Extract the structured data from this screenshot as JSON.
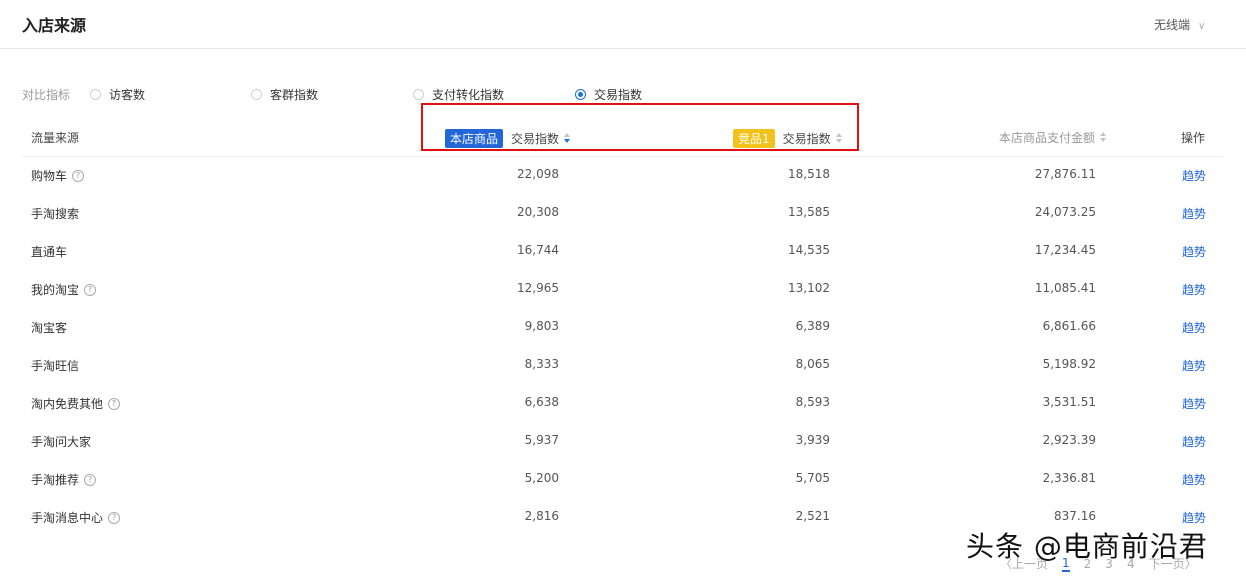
{
  "header": {
    "title": "入店来源",
    "device_select": "无线端"
  },
  "indicators": {
    "label": "对比指标",
    "options": [
      {
        "label": "访客数",
        "checked": false
      },
      {
        "label": "客群指数",
        "checked": false
      },
      {
        "label": "支付转化指数",
        "checked": false
      },
      {
        "label": "交易指数",
        "checked": true
      }
    ]
  },
  "table": {
    "columns": {
      "source": "流量来源",
      "store_tag": "本店商品",
      "store_metric": "交易指数",
      "comp_tag": "竞品1",
      "comp_metric": "交易指数",
      "amount": "本店商品支付金额",
      "action": "操作"
    },
    "rows": [
      {
        "source": "购物车",
        "help": true,
        "store": "22,098",
        "comp": "18,518",
        "amount": "27,876.11",
        "action": "趋势"
      },
      {
        "source": "手淘搜索",
        "help": false,
        "store": "20,308",
        "comp": "13,585",
        "amount": "24,073.25",
        "action": "趋势"
      },
      {
        "source": "直通车",
        "help": false,
        "store": "16,744",
        "comp": "14,535",
        "amount": "17,234.45",
        "action": "趋势"
      },
      {
        "source": "我的淘宝",
        "help": true,
        "store": "12,965",
        "comp": "13,102",
        "amount": "11,085.41",
        "action": "趋势"
      },
      {
        "source": "淘宝客",
        "help": false,
        "store": "9,803",
        "comp": "6,389",
        "amount": "6,861.66",
        "action": "趋势"
      },
      {
        "source": "手淘旺信",
        "help": false,
        "store": "8,333",
        "comp": "8,065",
        "amount": "5,198.92",
        "action": "趋势"
      },
      {
        "source": "淘内免费其他",
        "help": true,
        "store": "6,638",
        "comp": "8,593",
        "amount": "3,531.51",
        "action": "趋势"
      },
      {
        "source": "手淘问大家",
        "help": false,
        "store": "5,937",
        "comp": "3,939",
        "amount": "2,923.39",
        "action": "趋势"
      },
      {
        "source": "手淘推荐",
        "help": true,
        "store": "5,200",
        "comp": "5,705",
        "amount": "2,336.81",
        "action": "趋势"
      },
      {
        "source": "手淘消息中心",
        "help": true,
        "store": "2,816",
        "comp": "2,521",
        "amount": "837.16",
        "action": "趋势"
      }
    ]
  },
  "pager": {
    "prev": "〈上一页",
    "pages": [
      "1",
      "2",
      "3",
      "4"
    ],
    "current": "1",
    "next": "下一页〉"
  },
  "watermark": "头条 @电商前沿君",
  "colors": {
    "accent": "#2266d8",
    "highlight_border": "#e01010",
    "competitor_tag": "#f2c21b"
  }
}
